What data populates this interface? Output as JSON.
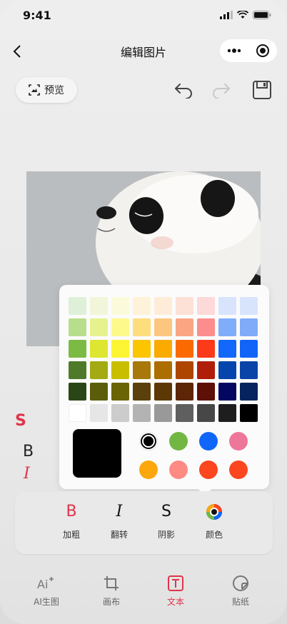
{
  "status_bar": {
    "time": "9:41"
  },
  "nav": {
    "title": "编辑图片"
  },
  "toolbar": {
    "preview_label": "预览"
  },
  "samples": {
    "shadow": "S",
    "bold": "B",
    "italic": "I"
  },
  "palette": {
    "grid": [
      [
        "#dff0d8",
        "#f1f6da",
        "#fbfbdc",
        "#fef3d8",
        "#feecd8",
        "#fde0d6",
        "#fdd9d9",
        "#d8e4fc",
        "#d8e4fb"
      ],
      [
        "#b6de8c",
        "#e6f28e",
        "#fdf98b",
        "#fedd7c",
        "#fdc67f",
        "#fca583",
        "#fb8e8c",
        "#7fadfb",
        "#7fabf7"
      ],
      [
        "#7cbb43",
        "#dde630",
        "#fbf533",
        "#fdc400",
        "#fbaa00",
        "#fb6a00",
        "#fb3a1a",
        "#1168fb",
        "#1264f7"
      ],
      [
        "#4f7a2a",
        "#a3aa12",
        "#c9bf00",
        "#a9780a",
        "#ad6e00",
        "#ae4600",
        "#b01e0a",
        "#0546ac",
        "#0b44a8"
      ],
      [
        "#2b4616",
        "#5c5d0a",
        "#6a6404",
        "#5a400a",
        "#5c3904",
        "#5d2604",
        "#5e0f06",
        "#030762",
        "#06235f"
      ],
      [
        "#ffffff",
        "#e6e6e6",
        "#cccccc",
        "#b3b3b3",
        "#999999",
        "#5f5f5f",
        "#474747",
        "#1e1e1e",
        "#000000"
      ]
    ],
    "current_color": "#000000",
    "presets": [
      "#000000",
      "#72b744",
      "#1166fa",
      "#ee7799",
      "#fca70b",
      "#fd8b83",
      "#fb461f",
      "#fb461f"
    ],
    "selected_index": 0
  },
  "style_options": [
    {
      "glyph": "B",
      "label": "加粗",
      "color": "#e0344a"
    },
    {
      "glyph": "I",
      "label": "翻转",
      "color": "#222222"
    },
    {
      "glyph": "S",
      "label": "阴影",
      "color": "#222222"
    },
    {
      "glyph": "",
      "label": "颜色",
      "color": "#222222"
    }
  ],
  "tabs": [
    {
      "label": "AI生图",
      "active": false
    },
    {
      "label": "画布",
      "active": false
    },
    {
      "label": "文本",
      "active": true
    },
    {
      "label": "贴纸",
      "active": false
    }
  ],
  "accent": "#e0344a"
}
